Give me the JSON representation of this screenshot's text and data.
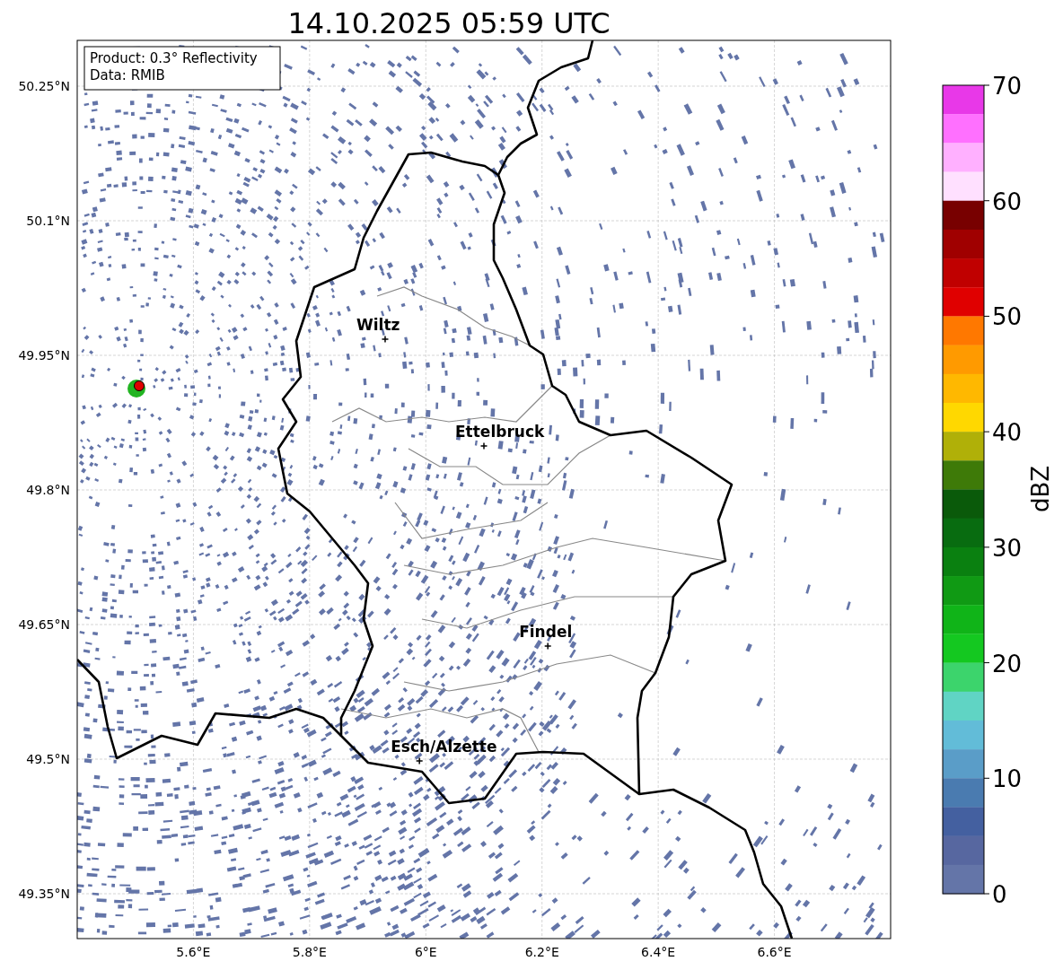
{
  "title": "14.10.2025 05:59 UTC",
  "info_box": [
    "Product: 0.3° Reflectivity",
    "Data: RMIB"
  ],
  "map": {
    "lat_ticks": [
      "50.25°N",
      "50.1°N",
      "49.95°N",
      "49.8°N",
      "49.65°N",
      "49.5°N",
      "49.35°N"
    ],
    "lon_ticks": [
      "5.6°E",
      "5.8°E",
      "6°E",
      "6.2°E",
      "6.4°E",
      "6.6°E"
    ],
    "cities": [
      {
        "name": "Wiltz"
      },
      {
        "name": "Ettelbruck"
      },
      {
        "name": "Findel"
      },
      {
        "name": "Esch/Alzette"
      }
    ]
  },
  "colorbar": {
    "label": "dBZ",
    "ticks": [
      "70",
      "60",
      "50",
      "40",
      "30",
      "20",
      "10",
      "0"
    ],
    "bands": [
      {
        "color": "#e838e8"
      },
      {
        "color": "#ff70ff"
      },
      {
        "color": "#ffb0ff"
      },
      {
        "color": "#ffe0ff"
      },
      {
        "color": "#780000"
      },
      {
        "color": "#a00000"
      },
      {
        "color": "#c00000"
      },
      {
        "color": "#e00000"
      },
      {
        "color": "#ff7800"
      },
      {
        "color": "#ff9a00"
      },
      {
        "color": "#ffb800"
      },
      {
        "color": "#ffd800"
      },
      {
        "color": "#b0b008"
      },
      {
        "color": "#3e7a08"
      },
      {
        "color": "#0a5a0a"
      },
      {
        "color": "#086c10"
      },
      {
        "color": "#0a8010"
      },
      {
        "color": "#109a14"
      },
      {
        "color": "#10b418"
      },
      {
        "color": "#14c820"
      },
      {
        "color": "#3cd46c"
      },
      {
        "color": "#60d4c4"
      },
      {
        "color": "#62bcd8"
      },
      {
        "color": "#5a9dc8"
      },
      {
        "color": "#4a7bb0"
      },
      {
        "color": "#4460a0"
      },
      {
        "color": "#5767a0"
      },
      {
        "color": "#6475a8"
      }
    ]
  }
}
